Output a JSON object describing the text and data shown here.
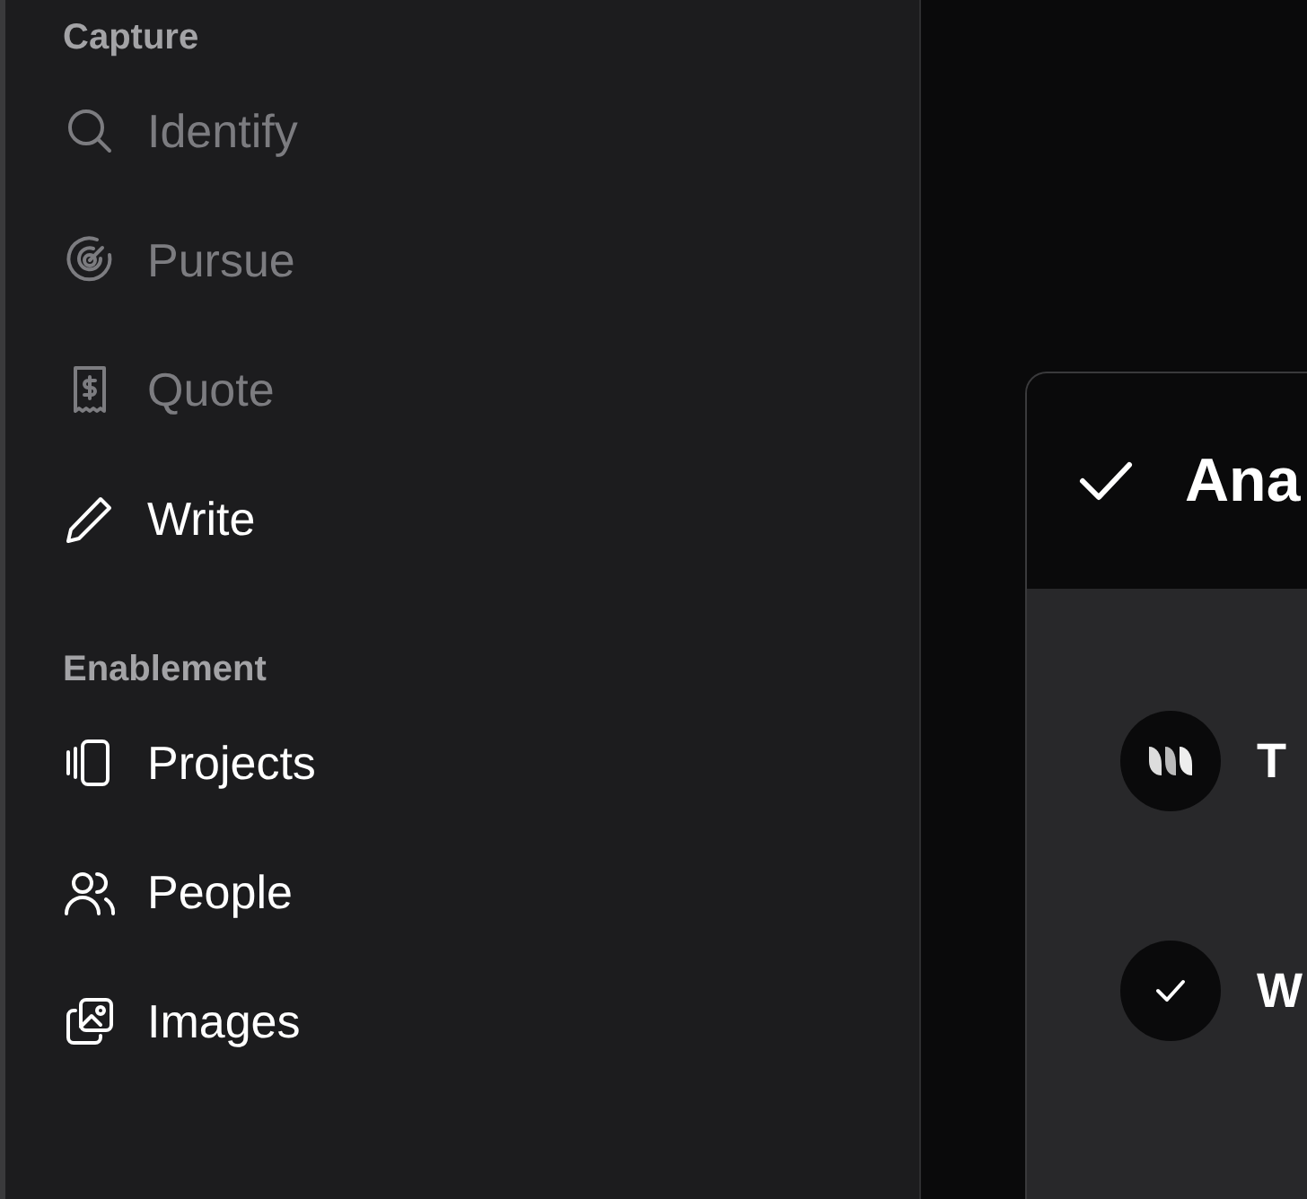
{
  "sidebar": {
    "sections": [
      {
        "title": "Capture",
        "items": [
          {
            "label": "Identify",
            "kind": "search",
            "disabled": true
          },
          {
            "label": "Pursue",
            "kind": "radar",
            "disabled": true
          },
          {
            "label": "Quote",
            "kind": "receipt",
            "disabled": true
          },
          {
            "label": "Write",
            "kind": "pencil",
            "disabled": false
          }
        ]
      },
      {
        "title": "Enablement",
        "items": [
          {
            "label": "Projects",
            "kind": "cards",
            "disabled": false
          },
          {
            "label": "People",
            "kind": "people",
            "disabled": false
          },
          {
            "label": "Images",
            "kind": "images",
            "disabled": false
          }
        ]
      }
    ]
  },
  "card": {
    "title": "Ana",
    "done": true,
    "rows": [
      {
        "kind": "logo",
        "text": "T"
      },
      {
        "kind": "check",
        "text": "W"
      }
    ]
  }
}
